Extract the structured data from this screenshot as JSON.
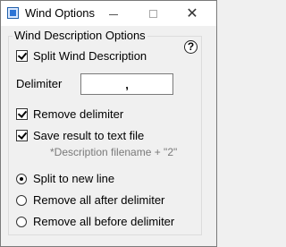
{
  "window": {
    "title": "Wind Options",
    "close_glyph": "✕"
  },
  "group": {
    "title": "Wind Description Options",
    "help_icon": "?"
  },
  "options": {
    "split_desc": {
      "label": "Split Wind Description",
      "checked": true
    },
    "delimiter": {
      "label": "Delimiter",
      "value": ","
    },
    "remove_delim": {
      "label": "Remove delimiter",
      "checked": true
    },
    "save_result": {
      "label": "Save result to text file",
      "checked": true
    },
    "note": "*Description filename + \"2\""
  },
  "split_mode": {
    "selected": "new_line",
    "radios": [
      {
        "key": "new_line",
        "label": "Split to new line"
      },
      {
        "key": "after",
        "label": "Remove all after delimiter"
      },
      {
        "key": "before",
        "label": "Remove all before delimiter"
      }
    ]
  }
}
